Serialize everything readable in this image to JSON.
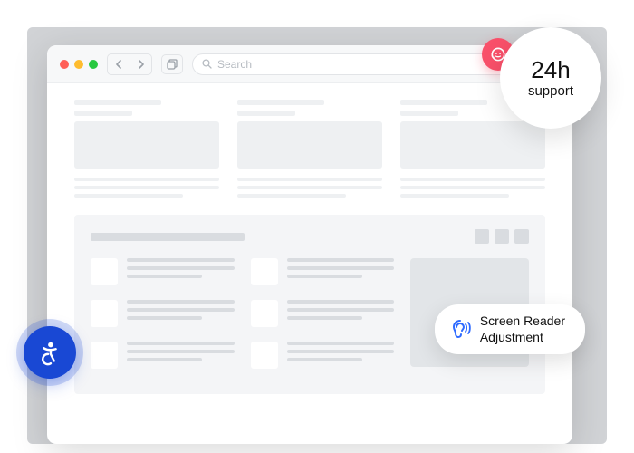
{
  "browser": {
    "traffic_lights": [
      "#ff5f57",
      "#febc2e",
      "#28c840"
    ],
    "search_placeholder": "Search"
  },
  "overlays": {
    "support": {
      "headline": "24h",
      "subline": "support"
    },
    "screen_reader": {
      "line1": "Screen Reader",
      "line2": "Adjustment"
    }
  },
  "colors": {
    "support_icon_bg": "#f9506a",
    "a11y_btn_bg": "#1948d4",
    "ear_icon": "#2f6bff"
  }
}
